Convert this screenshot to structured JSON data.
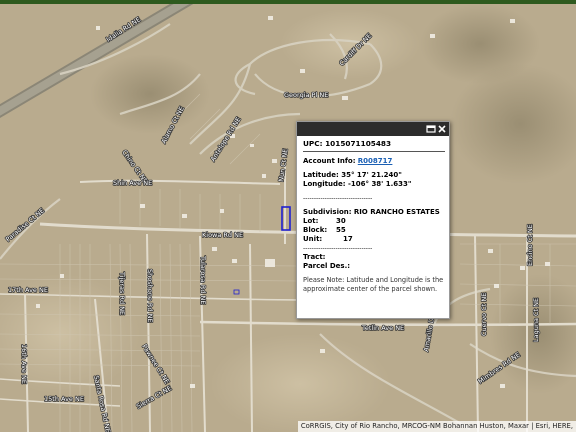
{
  "map": {
    "streets": [
      "Idalia Rd NE",
      "Cardiff Dr NE",
      "Georgia Pl NE",
      "Alamo Ct NE",
      "Antelope Rd NE",
      "Chino Ct NE",
      "Shin Ave NE",
      "Paradise Ct NE",
      "Nun Ct NE",
      "Kiowa Rd NE",
      "Shoshone Rd NE",
      "Tularosa Rd NE",
      "17th Ave NE",
      "Tijeras Rd NE",
      "Pawnee Ct NE",
      "16th Ave NE",
      "15th Ave NE",
      "Santa Rosa Rd NE",
      "Sierra Ct NE",
      "Tetlin Ave NE",
      "Amarillo Dr NE",
      "Mimbres Rd NE",
      "Cuervo Ct NE",
      "Encino Ct NE",
      "Laguna Ct NE"
    ],
    "colors": {
      "imagery": "#b9ab8e",
      "selection": "#2020d0"
    }
  },
  "popup": {
    "upc": "UPC: 1015071105483",
    "account_label": "Account Info:",
    "account_value": "R008717",
    "latitude": "Latitude: 35° 17' 21.240\"",
    "longitude": "Longitude: -106° 38' 1.633\"",
    "separator": "--------------------------------",
    "subdivision_label": "Subdivision:",
    "subdivision_value": "RIO RANCHO ESTATES",
    "lot_label": "Lot:",
    "lot_value": "30",
    "block_label": "Block:",
    "block_value": "55",
    "unit_label": "Unit:",
    "unit_value": "17",
    "tract_label": "Tract:",
    "parcel_label": "Parcel Des.:",
    "note": "Please Note: Latitude and Longitude is the approximate center of the parcel shown.",
    "icons": {
      "maximize": "maximize-icon",
      "close": "close-icon"
    }
  },
  "attribution": "CoRRGIS, City of Rio Rancho, MRCOG-NM Bohannan Huston, Maxar | Esri, HERE,"
}
